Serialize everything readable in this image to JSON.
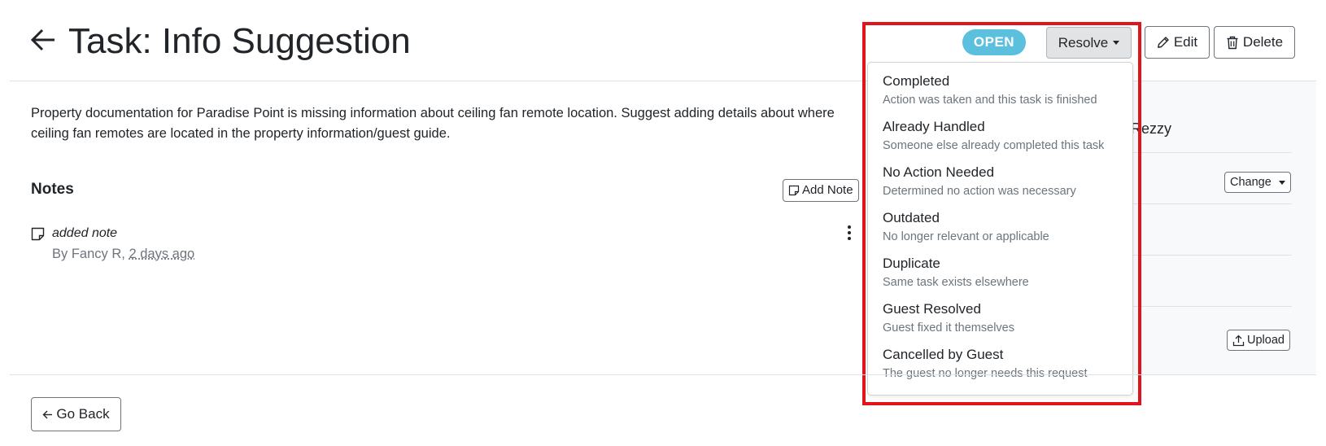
{
  "header": {
    "title": "Task: Info Suggestion",
    "status": "OPEN",
    "resolve_label": "Resolve",
    "edit_label": "Edit",
    "delete_label": "Delete"
  },
  "task": {
    "description": "Property documentation for Paradise Point is missing information about ceiling fan remote location. Suggest adding details about where ceiling fan remotes are located in the property information/guest guide."
  },
  "notes": {
    "heading": "Notes",
    "add_label": "Add Note",
    "items": [
      {
        "text": "added note",
        "author_prefix": "By Fancy R, ",
        "time": "2 days ago"
      }
    ]
  },
  "side_panel": {
    "assignee_fragment": "Rezzy",
    "change_label": "Change",
    "upload_label": "Upload"
  },
  "resolve_menu": {
    "options": [
      {
        "label": "Completed",
        "description": "Action was taken and this task is finished"
      },
      {
        "label": "Already Handled",
        "description": "Someone else already completed this task"
      },
      {
        "label": "No Action Needed",
        "description": "Determined no action was necessary"
      },
      {
        "label": "Outdated",
        "description": "No longer relevant or applicable"
      },
      {
        "label": "Duplicate",
        "description": "Same task exists elsewhere"
      },
      {
        "label": "Guest Resolved",
        "description": "Guest fixed it themselves"
      },
      {
        "label": "Cancelled by Guest",
        "description": "The guest no longer needs this request"
      }
    ]
  },
  "footer": {
    "go_back_label": "Go Back"
  },
  "colors": {
    "status_badge": "#5bc0de",
    "highlight": "#e0151b",
    "muted_text": "#6c757d"
  },
  "icons": [
    "arrow-left-icon",
    "pencil-icon",
    "trash-icon",
    "sticky-note-icon",
    "kebab-icon",
    "upload-icon",
    "caret-down-icon"
  ]
}
